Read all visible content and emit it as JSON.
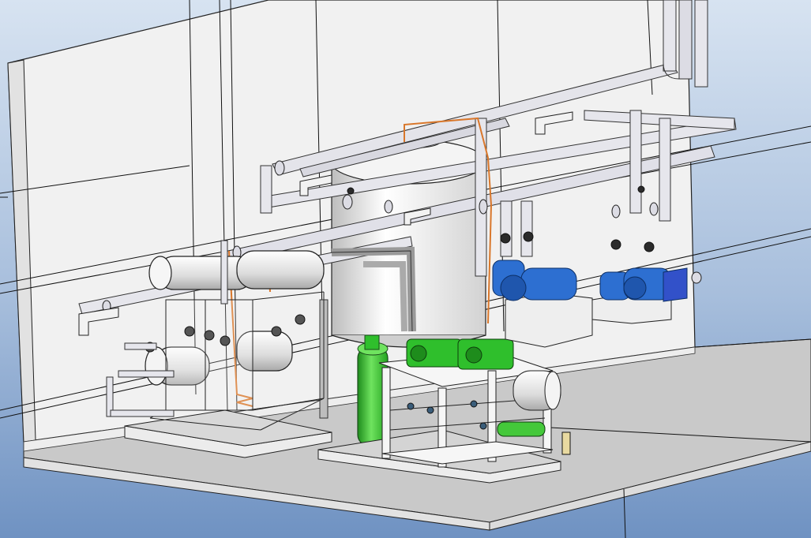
{
  "scene": {
    "kind": "cad-3d-isometric-model",
    "components": [
      "back-wall",
      "floor-slab",
      "storage-tank",
      "pipe-rack",
      "pump-skid-blue",
      "compressor-skid-green",
      "heat-exchanger-skid",
      "horizontal-receiver",
      "green-vertical-vessel",
      "pipe-supports",
      "copper-line"
    ]
  },
  "colors": {
    "sky_top": "#d7e3f1",
    "sky_bottom": "#6f92c2",
    "wall": "#f1f1f1",
    "floor": "#c8c8c8",
    "pipe": "#e6e6ea",
    "pipe_shade": "#b4b4be",
    "steel": "#eeeeee",
    "pump_blue": "#2d6fd1",
    "compressor_green": "#2fbf2c",
    "vessel_green": "#44c83a",
    "copper": "#d9772b",
    "outline": "#222222"
  }
}
